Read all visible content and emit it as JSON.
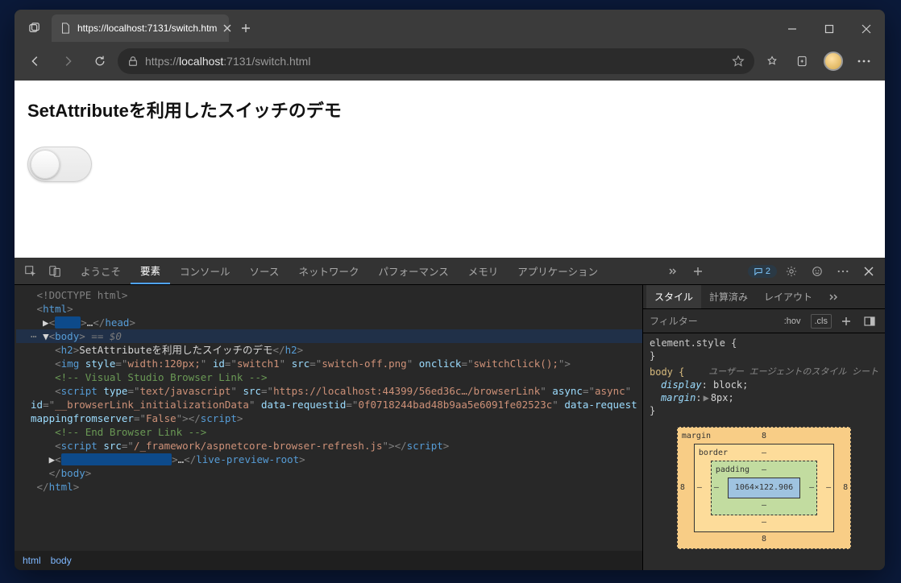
{
  "titlebar": {
    "tab_title": "https://localhost:7131/switch.htm"
  },
  "navbar": {
    "url_prefix": "https://",
    "url_host": "localhost",
    "url_path": ":7131/switch.html"
  },
  "page": {
    "heading": "SetAttributeを利用したスイッチのデモ"
  },
  "devtools": {
    "top_tabs": {
      "welcome": "ようこそ",
      "elements": "要素",
      "console": "コンソール",
      "sources": "ソース",
      "network": "ネットワーク",
      "performance": "パフォーマンス",
      "memory": "メモリ",
      "application": "アプリケーション"
    },
    "issues_count": "2",
    "dom": {
      "doctype": "<!DOCTYPE html>",
      "html_open": "html",
      "head_ellipsis": "…",
      "head_close": "head",
      "body": "body",
      "body_marker": " == $0",
      "h2_text": "SetAttributeを利用したスイッチのデモ",
      "img_style": "width:120px;",
      "img_id": "switch1",
      "img_src": "switch-off.png",
      "img_onclick": "switchClick();",
      "comment_vs": "<!-- Visual Studio Browser Link -->",
      "script1_type": "text/javascript",
      "script1_src": "https://localhost:44399/56ed36c…/browserLink",
      "script1_async": "async",
      "script1_id": "__browserLink_initializationData",
      "script1_reqid": "0f0718244bad48b9aa5e6091fe02523c",
      "script1_mapping_attr": "data-requestmappingfromserver",
      "script1_mapping_val": "False",
      "comment_end": "<!-- End Browser Link -->",
      "script2_src": "/_framework/aspnetcore-browser-refresh.js",
      "lpr_ellipsis": "…",
      "lpr_tag": "live-preview-root"
    },
    "breadcrumb": {
      "html": "html",
      "body": "body"
    },
    "styles": {
      "tab_styles": "スタイル",
      "tab_computed": "計算済み",
      "tab_layout": "レイアウト",
      "filter_placeholder": "フィルター",
      "hov": ":hov",
      "cls": ".cls",
      "el_style": "element.style {",
      "close": "}",
      "body_sel": "body {",
      "origin": "ユーザー エージェントのスタイル シート",
      "d_display_p": "display",
      "d_display_v": "block",
      "d_margin_p": "margin",
      "d_margin_v": "8px"
    },
    "boxmodel": {
      "margin_label": "margin",
      "border_label": "border",
      "padding_label": "padding",
      "content": "1064×122.906",
      "m_t": "8",
      "m_r": "8",
      "m_b": "8",
      "m_l": "8",
      "b": "–",
      "p": "–"
    }
  }
}
